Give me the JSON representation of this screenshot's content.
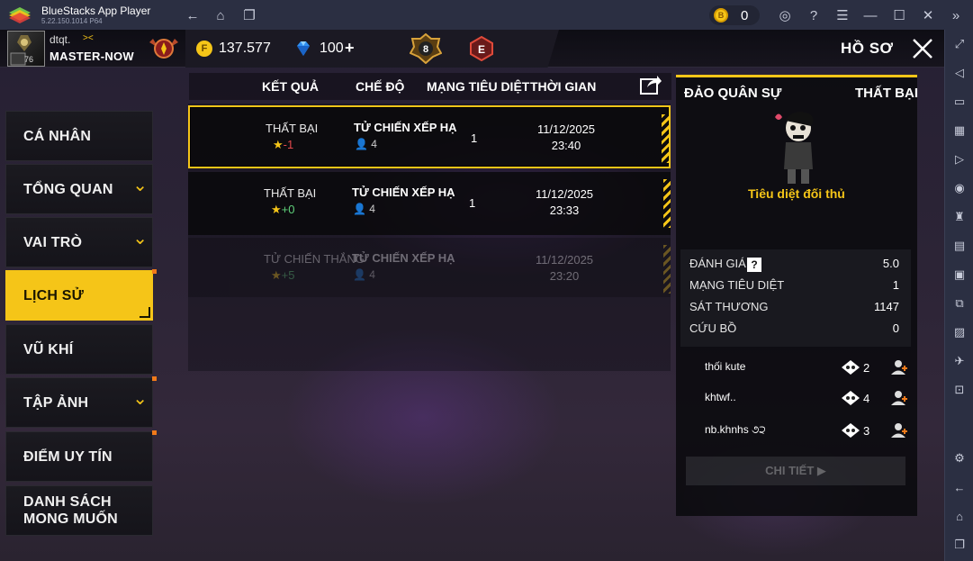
{
  "window": {
    "title": "BlueStacks App Player",
    "version": "5.22.150.1014  P64",
    "coins": "0"
  },
  "topbar": {
    "player_name": "dtqt.",
    "player_tag": "><",
    "rank_title": "MASTER-NOW",
    "avatar_level": "76",
    "gold": "137.577",
    "diamonds": "100",
    "diamond_plus": "+",
    "badge_b": "8",
    "badge_e": "E",
    "page_title": "HỒ SƠ"
  },
  "nav": [
    {
      "label": "CÁ NHÂN",
      "chevron": false,
      "dot": false,
      "active": false
    },
    {
      "label": "TỔNG QUAN",
      "chevron": true,
      "dot": false,
      "active": false
    },
    {
      "label": "VAI TRÒ",
      "chevron": true,
      "dot": false,
      "active": false
    },
    {
      "label": "LỊCH SỬ",
      "chevron": false,
      "dot": true,
      "active": true
    },
    {
      "label": "VŨ KHÍ",
      "chevron": false,
      "dot": false,
      "active": false
    },
    {
      "label": "TẬP ẢNH",
      "chevron": true,
      "dot": true,
      "active": false
    },
    {
      "label": "ĐIỂM UY TÍN",
      "chevron": false,
      "dot": true,
      "active": false
    },
    {
      "label": "DANH SÁCH\nMONG MUỐN",
      "chevron": false,
      "dot": false,
      "active": false
    }
  ],
  "table": {
    "headers": [
      "KẾT QUẢ",
      "CHẾ ĐỘ",
      "MẠNG TIÊU DIỆT",
      "THỜI GIAN"
    ],
    "rows": [
      {
        "result": "THẤT BẠI",
        "points": "-1",
        "points_color": "#e0484a",
        "mode": "TỬ CHIẾN XẾP HẠ",
        "squad": "4",
        "kills": "1",
        "date": "11/12/2025",
        "time": "23:40"
      },
      {
        "result": "THẤT BẠI",
        "points": "+0",
        "points_color": "#5fd07a",
        "mode": "TỬ CHIẾN XẾP HẠ",
        "squad": "4",
        "kills": "1",
        "date": "11/12/2025",
        "time": "23:33"
      },
      {
        "result": "TỬ CHIẾN THẮNG",
        "points": "+5",
        "points_color": "#5fd07a",
        "mode": "TỬ CHIẾN XẾP HẠ",
        "squad": "4",
        "kills": "",
        "date": "11/12/2025",
        "time": "23:20"
      }
    ]
  },
  "detail": {
    "map": "ĐẢO QUÂN SỰ",
    "result": "THẤT BẠI",
    "caption": "Tiêu diệt đối thủ",
    "stats": [
      {
        "label": "ĐÁNH GIÁ",
        "value": "5.0"
      },
      {
        "label": "MẠNG TIÊU DIỆT",
        "value": "1"
      },
      {
        "label": "SÁT THƯƠNG",
        "value": "1147"
      },
      {
        "label": "CỨU BỒ",
        "value": "0"
      }
    ],
    "squad": [
      {
        "name": "thối kute",
        "kills": "2"
      },
      {
        "name": "khtwf..",
        "kills": "4"
      },
      {
        "name": "nb.khnhs ૭੨",
        "kills": "3"
      }
    ],
    "button": "CHI TIẾT ▶"
  },
  "colors": {
    "accent": "#f5c518",
    "panel": "#0a0a0e"
  }
}
